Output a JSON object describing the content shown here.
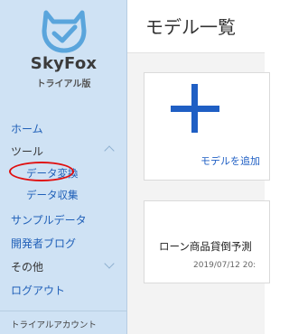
{
  "app": {
    "name": "SkyFox",
    "edition": "トライアル版"
  },
  "sidebar": {
    "items": [
      {
        "label": "ホーム"
      },
      {
        "label": "ツール"
      },
      {
        "label": "データ変換"
      },
      {
        "label": "データ収集"
      },
      {
        "label": "サンプルデータ"
      },
      {
        "label": "開発者ブログ"
      },
      {
        "label": "その他"
      },
      {
        "label": "ログアウト"
      }
    ],
    "footer": "トライアルアカウント"
  },
  "main": {
    "title": "モデル一覧",
    "add_card_label": "モデルを追加",
    "models": [
      {
        "name": "ローン商品貸倒予測",
        "date": "2019/07/12 20:"
      }
    ]
  },
  "colors": {
    "sidebar_bg": "#cfe2f4",
    "link": "#2060b8",
    "accent": "#1f5fc4",
    "highlight": "#e01010",
    "logo": "#5aa5dc"
  },
  "icons": {
    "logo": "fox-check-icon",
    "add": "plus-icon"
  }
}
